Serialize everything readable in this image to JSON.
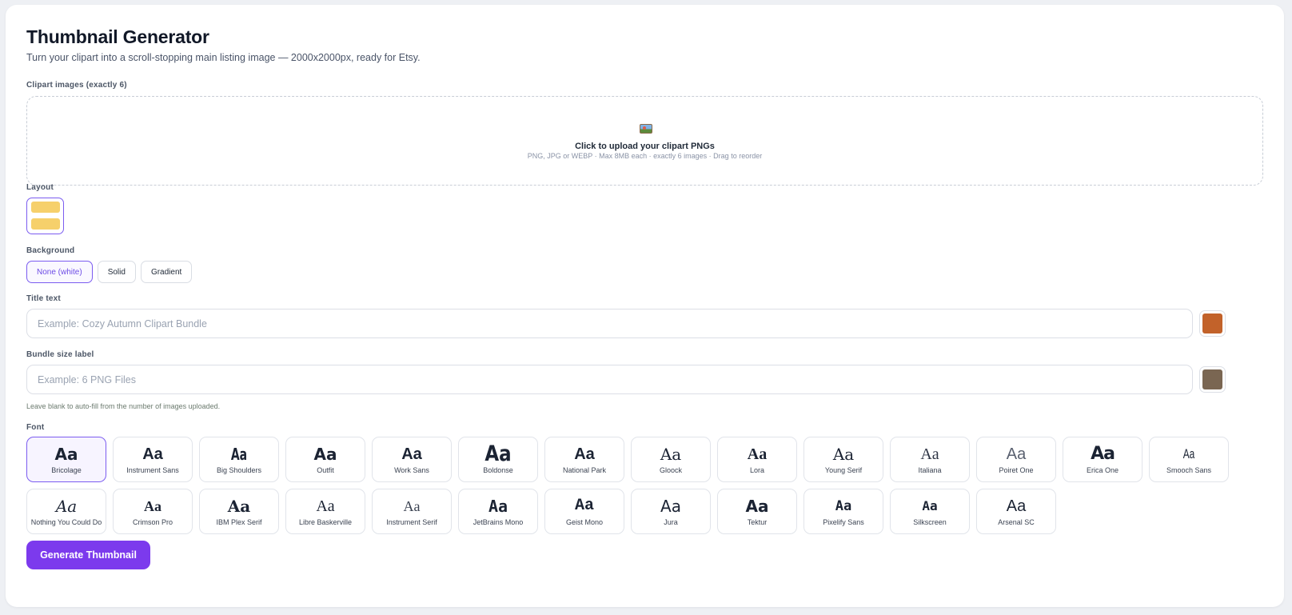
{
  "header": {
    "title": "Thumbnail Generator",
    "subtitle": "Turn your clipart into a scroll-stopping main listing image — 2000x2000px, ready for Etsy."
  },
  "clipart": {
    "label": "Clipart images (exactly 6)",
    "icon": "framed-picture-icon",
    "upload_title": "Click to upload your clipart PNGs",
    "upload_hint": "PNG, JPG or WEBP · Max 8MB each · exactly 6 images · Drag to reorder"
  },
  "layout": {
    "label": "Layout",
    "selected_color": "#f6d06b"
  },
  "background": {
    "label": "Background",
    "options": [
      "None (white)",
      "Solid",
      "Gradient"
    ],
    "selected": "None (white)"
  },
  "title_text": {
    "label": "Title text",
    "placeholder": "Example: Cozy Autumn Clipart Bundle",
    "value": "",
    "color": "#c2622a"
  },
  "bundle_size": {
    "label": "Bundle size label",
    "placeholder": "Example: 6 PNG Files",
    "value": "",
    "color": "#7a6652",
    "help": "Leave blank to auto-fill from the number of images uploaded."
  },
  "font": {
    "label": "Font",
    "sample": "Aa",
    "selected": "Bricolage",
    "options": [
      "Bricolage",
      "Instrument Sans",
      "Big Shoulders",
      "Outfit",
      "Work Sans",
      "Boldonse",
      "National Park",
      "Gloock",
      "Lora",
      "Young Serif",
      "Italiana",
      "Poiret One",
      "Erica One",
      "Smooch Sans",
      "Nothing You Could Do",
      "Crimson Pro",
      "IBM Plex Serif",
      "Libre Baskerville",
      "Instrument Serif",
      "JetBrains Mono",
      "Geist Mono",
      "Jura",
      "Tektur",
      "Pixelify Sans",
      "Silkscreen",
      "Arsenal SC"
    ]
  },
  "actions": {
    "generate_label": "Generate Thumbnail",
    "accent": "#7c3aed"
  }
}
